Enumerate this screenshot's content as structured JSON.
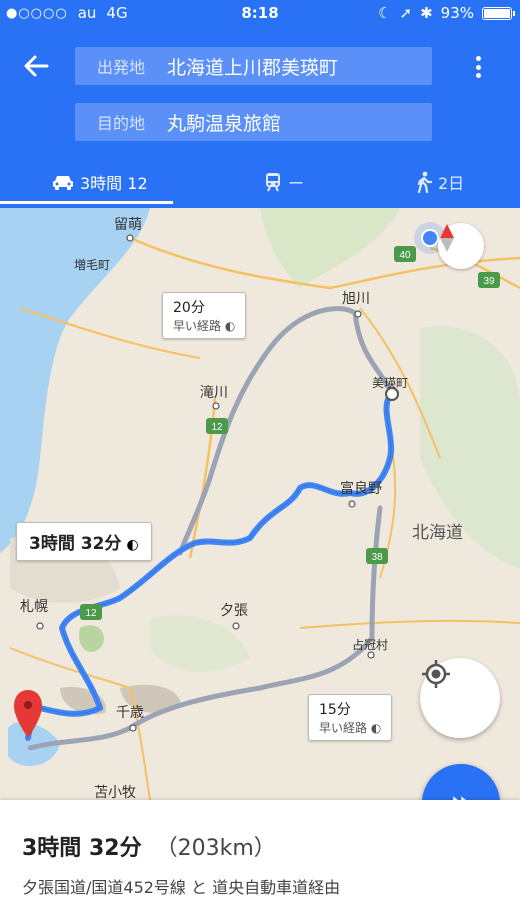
{
  "status": {
    "carrier": "au",
    "network": "4G",
    "time": "8:18",
    "battery": "93%",
    "battery_level": 0.93
  },
  "header": {
    "origin_label": "出発地",
    "origin_value": "北海道上川郡美瑛町",
    "destination_label": "目的地",
    "destination_value": "丸駒温泉旅館",
    "modes": {
      "car": "3時間 12",
      "train": "ー",
      "walk": "2日"
    }
  },
  "map": {
    "places": {
      "rumoi": "留萌",
      "mashike": "増毛町",
      "asahikawa": "旭川",
      "biei": "美瑛町",
      "takikawa": "滝川",
      "furano": "富良野",
      "hokkaido": "北海道",
      "sapporo": "札幌",
      "yubari": "夕張",
      "shimukappu": "占冠村",
      "chitose": "千歳",
      "tomakomai": "苫小牧"
    },
    "shields": {
      "r40": "40",
      "r39": "39",
      "r12a": "12",
      "r38": "38",
      "r12b": "12"
    },
    "alt_route_1": {
      "time": "20分",
      "note": "早い経路"
    },
    "alt_route_2": {
      "time": "15分",
      "note": "早い経路"
    },
    "main_route": {
      "time": "3時間 32分"
    }
  },
  "sheet": {
    "duration": "3時間 32分",
    "distance": "（203km）",
    "via": "夕張国道/国道452号線 と 道央自動車道経由"
  },
  "colors": {
    "primary": "#2a72f5",
    "route": "#4285f4",
    "alt_route": "#9aa4b4"
  }
}
